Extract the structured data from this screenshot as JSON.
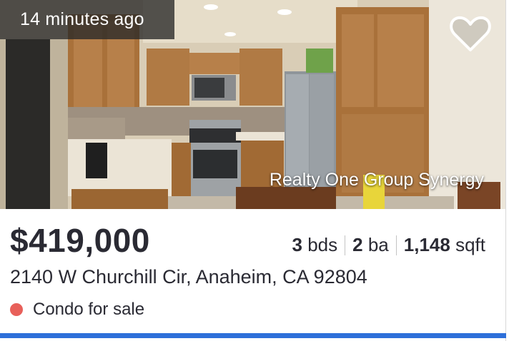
{
  "listing": {
    "time_ago": "14 minutes ago",
    "broker": "Realty One Group Synergy",
    "price": "$419,000",
    "beds": "3",
    "beds_label": "bds",
    "baths": "2",
    "baths_label": "ba",
    "sqft": "1,148",
    "sqft_label": "sqft",
    "address": "2140 W Churchill Cir, Anaheim, CA 92804",
    "status": "Condo for sale"
  },
  "icons": {
    "favorite": "heart-outline-icon",
    "status_dot": "status-dot-icon"
  },
  "colors": {
    "status_dot": "#e8605a",
    "accent": "#2d6fd9",
    "text": "#2a2a33"
  }
}
